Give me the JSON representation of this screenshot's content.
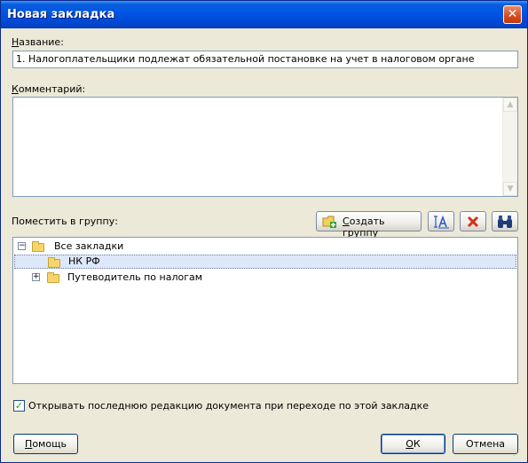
{
  "window": {
    "title": "Новая закладка",
    "close_glyph": "✕"
  },
  "name_field": {
    "label": "Название:",
    "label_underline": "Н",
    "label_rest": "азвание:",
    "value": "1. Налогоплательщики подлежат обязательной постановке на учет в налоговом органе"
  },
  "comment_field": {
    "label_underline": "К",
    "label_rest": "омментарий:",
    "value": ""
  },
  "group": {
    "label": "Поместить в группу:",
    "create_button_underline": "С",
    "create_button_rest": "оздать группу",
    "rename_icon": "rename-icon",
    "delete_icon": "delete-icon",
    "find_icon": "binoculars-icon"
  },
  "tree": {
    "nodes": [
      {
        "label": "Все закладки",
        "expander": "−",
        "level": 0
      },
      {
        "label": "НК РФ",
        "expander": "",
        "level": 1,
        "selected": true
      },
      {
        "label": "Путеводитель по налогам",
        "expander": "+",
        "level": 0
      }
    ]
  },
  "open_latest": {
    "checked": true,
    "label": "Открывать последнюю редакцию документа при переходе по этой закладке"
  },
  "footer": {
    "help_underline": "П",
    "help_rest": "омощь",
    "ok_underline": "О",
    "ok_rest": "К",
    "cancel_label": "Отмена"
  }
}
